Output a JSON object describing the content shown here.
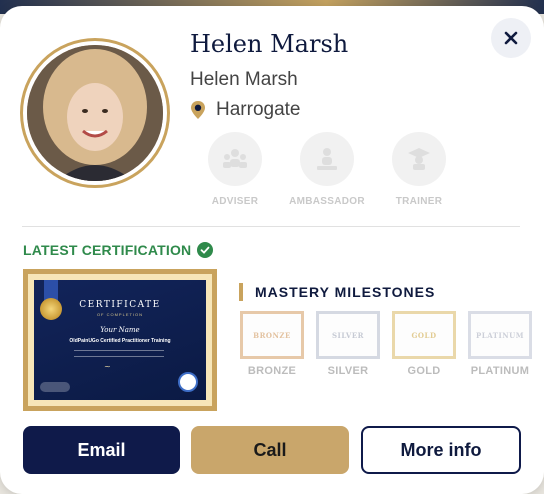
{
  "profile": {
    "title_name": "Helen Marsh",
    "subtitle_name": "Helen Marsh",
    "location": "Harrogate"
  },
  "roles": [
    {
      "label": "ADVISER",
      "icon": "adviser-icon"
    },
    {
      "label": "AMBASSADOR",
      "icon": "ambassador-icon"
    },
    {
      "label": "TRAINER",
      "icon": "trainer-icon"
    }
  ],
  "certification": {
    "heading": "LATEST CERTIFICATION",
    "certificate": {
      "title": "CERTIFICATE",
      "subtitle": "OF COMPLETION",
      "name": "Your Name",
      "course": "OldPainUGo Certified Practitioner Training"
    }
  },
  "mastery": {
    "heading": "MASTERY MILESTONES",
    "milestones": [
      {
        "label": "BRONZE",
        "frame_text": "BRONZE",
        "color": "#e7c9a9"
      },
      {
        "label": "SILVER",
        "frame_text": "SILVER",
        "color": "#d5d9e2"
      },
      {
        "label": "GOLD",
        "frame_text": "GOLD",
        "color": "#ead8aa"
      },
      {
        "label": "PLATINUM",
        "frame_text": "PLATINUM",
        "color": "#dadde6"
      }
    ]
  },
  "actions": {
    "email": "Email",
    "call": "Call",
    "more": "More info"
  },
  "colors": {
    "navy": "#0f1a4a",
    "gold": "#c9a35d",
    "green": "#2f8a4b"
  }
}
